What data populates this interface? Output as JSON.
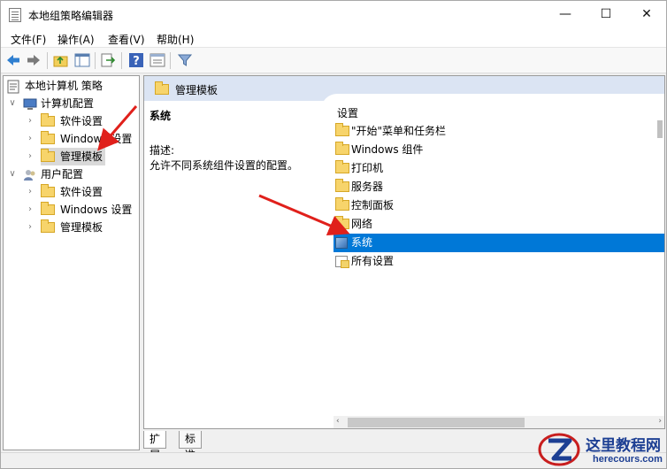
{
  "window": {
    "title": "本地组策略编辑器",
    "minimize": "—",
    "maximize": "☐",
    "close": "✕"
  },
  "menu": [
    "文件(F)",
    "操作(A)",
    "查看(V)",
    "帮助(H)"
  ],
  "toolbar": {
    "icons": [
      "back-arrow-icon",
      "forward-arrow-icon",
      "up-folder-icon",
      "show-hide-tree-icon",
      "export-list-icon",
      "help-icon",
      "properties-icon",
      "filter-icon"
    ]
  },
  "tree": {
    "root": "本地计算机 策略",
    "computer": "计算机配置",
    "computer_children": [
      "软件设置",
      "Windows 设置",
      "管理模板"
    ],
    "user": "用户配置",
    "user_children": [
      "软件设置",
      "Windows 设置",
      "管理模板"
    ]
  },
  "main": {
    "header": "管理模板",
    "selected_name": "系统",
    "desc_label": "描述:",
    "desc_text": "允许不同系统组件设置的配置。",
    "column_header": "设置",
    "items": [
      "\"开始\"菜单和任务栏",
      "Windows 组件",
      "打印机",
      "服务器",
      "控制面板",
      "网络",
      "系统",
      "所有设置"
    ]
  },
  "tabs": [
    "扩展",
    "标准"
  ],
  "watermark": {
    "title": "这里教程网",
    "url": "herecours.com"
  },
  "colors": {
    "selection": "#0078d7",
    "header_bg": "#dbe4f3",
    "arrow": "#e0201b"
  }
}
